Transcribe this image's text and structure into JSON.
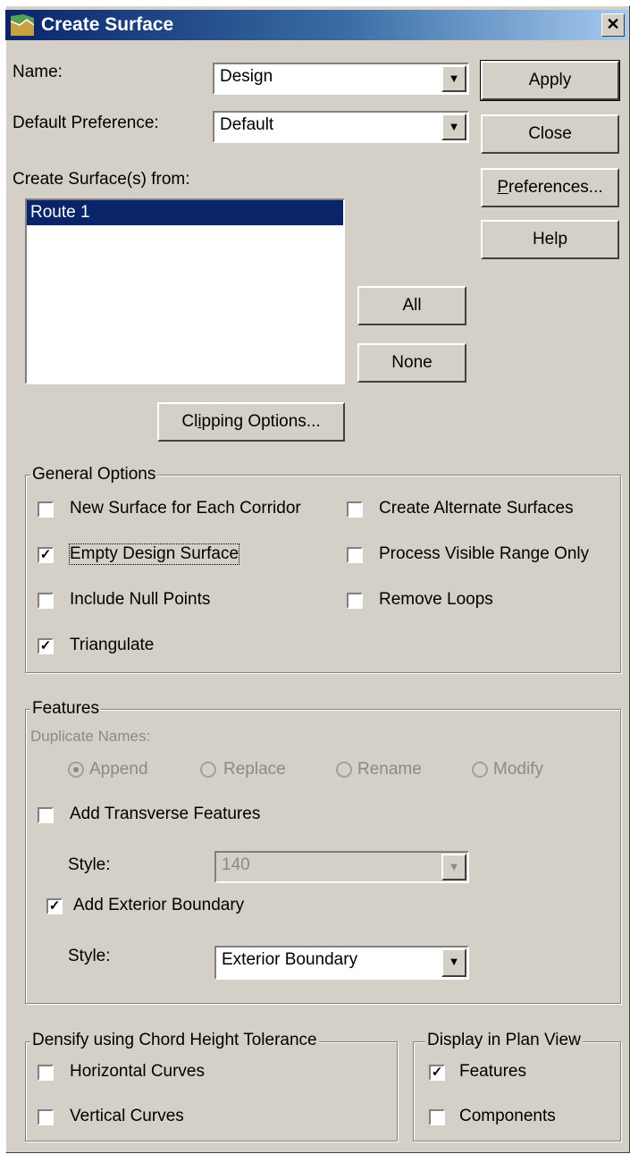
{
  "window": {
    "title": "Create Surface",
    "close_glyph": "✕"
  },
  "name": {
    "label": "Name:",
    "value": "Design"
  },
  "default_preference": {
    "label": "Default Preference:",
    "value": "Default"
  },
  "buttons": {
    "apply": "Apply",
    "close": "Close",
    "preferences_underlined": "P",
    "preferences_rest": "references...",
    "help": "Help",
    "all": "All",
    "none": "None",
    "clipping_prefix": "Cl",
    "clipping_underlined": "i",
    "clipping_rest": "pping Options..."
  },
  "create_from": {
    "label": "Create Surface(s) from:",
    "items": [
      "Route 1"
    ]
  },
  "general_options": {
    "title": "General Options",
    "new_surface": {
      "label": "New Surface for Each Corridor",
      "checked": false
    },
    "create_alternate": {
      "label": "Create Alternate Surfaces",
      "checked": false
    },
    "empty_design": {
      "label": "Empty Design Surface",
      "checked": true
    },
    "process_visible": {
      "label": "Process Visible Range Only",
      "checked": false
    },
    "include_null": {
      "label": "Include Null Points",
      "checked": false
    },
    "remove_loops": {
      "label": "Remove Loops",
      "checked": false
    },
    "triangulate": {
      "label": "Triangulate",
      "checked": true
    }
  },
  "features": {
    "title": "Features",
    "duplicate_names_label": "Duplicate Names:",
    "radios": [
      "Append",
      "Replace",
      "Rename",
      "Modify"
    ],
    "selected_radio": "Append",
    "add_transverse": {
      "label": "Add Transverse Features",
      "checked": false
    },
    "style1_label": "Style:",
    "style1_value": "140",
    "add_exterior": {
      "label": "Add Exterior Boundary",
      "checked": true
    },
    "style2_label": "Style:",
    "style2_value": "Exterior Boundary"
  },
  "densify": {
    "title": "Densify using Chord Height Tolerance",
    "horizontal": {
      "label": "Horizontal Curves",
      "checked": false
    },
    "vertical": {
      "label": "Vertical Curves",
      "checked": false
    }
  },
  "display_plan": {
    "title": "Display in Plan View",
    "features": {
      "label": "Features",
      "checked": true
    },
    "components": {
      "label": "Components",
      "checked": false
    }
  },
  "glyphs": {
    "check": "✓",
    "dropdown": "▼"
  }
}
